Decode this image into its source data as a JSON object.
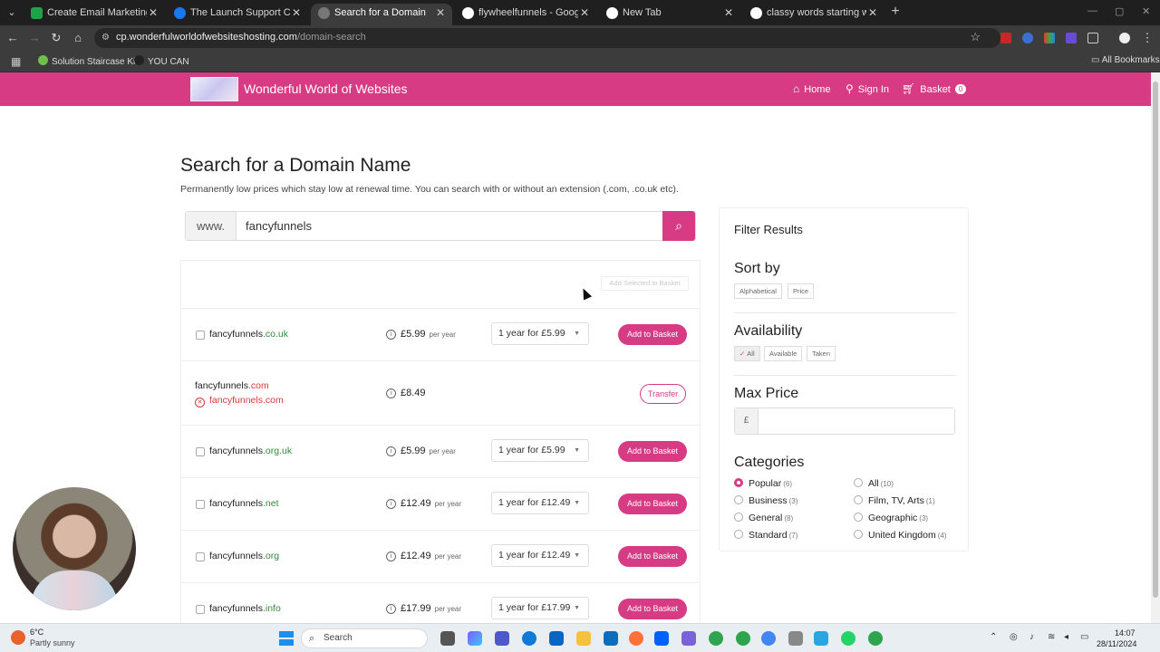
{
  "browser": {
    "tabs": [
      {
        "title": "Create Email Marketing Your A...",
        "fav_color": "#1fa34a"
      },
      {
        "title": "The Launch Support Club with",
        "fav_color": "#1877f2"
      },
      {
        "title": "Search for a Domain",
        "fav_color": "#888888"
      },
      {
        "title": "flywheelfunnels - Google Searc",
        "fav_color": "#ffffff"
      },
      {
        "title": "New Tab",
        "fav_color": "#ffffff"
      },
      {
        "title": "classy words starting with f - G",
        "fav_color": "#ffffff"
      }
    ],
    "url_host": "cp.wonderfulworldofwebsiteshosting.com",
    "url_path": "/domain-search",
    "bookmarks": [
      "Solution Staircase Ki...",
      "YOU CAN"
    ],
    "all_bookmarks": "All Bookmarks"
  },
  "site": {
    "name": "Wonderful World of Websites",
    "nav": {
      "home": "Home",
      "sign_in": "Sign In",
      "basket": "Basket",
      "basket_count": "0"
    },
    "brand_color": "#d63b84"
  },
  "main": {
    "heading": "Search for a Domain Name",
    "subtitle": "Permanently low prices which stay low at renewal time. You can search with or without an extension (.com, .co.uk etc).",
    "search": {
      "prefix": "www.",
      "value": "fancyfunnels"
    },
    "add_selected": "Add Selected to Basket",
    "results": [
      {
        "name": "fancyfunnels",
        "ext": ".co.uk",
        "price": "£5.99",
        "per": "per year",
        "term": "1 year for £5.99",
        "action": "Add to Basket"
      },
      {
        "name": "fancyfunnels",
        "ext": ".com",
        "price": "£8.49",
        "taken_label": "fancyfunnels.com",
        "action": "Transfer"
      },
      {
        "name": "fancyfunnels",
        "ext": ".org.uk",
        "price": "£5.99",
        "per": "per year",
        "term": "1 year for £5.99",
        "action": "Add to Basket"
      },
      {
        "name": "fancyfunnels",
        "ext": ".net",
        "price": "£12.49",
        "per": "per year",
        "term": "1 year for £12.49",
        "action": "Add to Basket"
      },
      {
        "name": "fancyfunnels",
        "ext": ".org",
        "price": "£12.49",
        "per": "per year",
        "term": "1 year for £12.49",
        "action": "Add to Basket"
      },
      {
        "name": "fancyfunnels",
        "ext": ".info",
        "price": "£17.99",
        "per": "per year",
        "term": "1 year for £17.99",
        "action": "Add to Basket"
      }
    ]
  },
  "filter": {
    "title": "Filter Results",
    "sort_by": {
      "label": "Sort by",
      "options": [
        "Alphabetical",
        "Price"
      ]
    },
    "availability": {
      "label": "Availability",
      "options": [
        "All",
        "Available",
        "Taken"
      ],
      "selected": "All"
    },
    "max_price": {
      "label": "Max Price",
      "currency": "£",
      "value": ""
    },
    "categories": {
      "label": "Categories",
      "items": [
        {
          "name": "Popular",
          "count": "(6)",
          "selected": true
        },
        {
          "name": "All",
          "count": "(10)",
          "selected": false
        },
        {
          "name": "Business",
          "count": "(3)",
          "selected": false
        },
        {
          "name": "Film, TV, Arts",
          "count": "(1)",
          "selected": false
        },
        {
          "name": "General",
          "count": "(8)",
          "selected": false
        },
        {
          "name": "Geographic",
          "count": "(3)",
          "selected": false
        },
        {
          "name": "Standard",
          "count": "(7)",
          "selected": false
        },
        {
          "name": "United Kingdom",
          "count": "(4)",
          "selected": false
        }
      ]
    }
  },
  "taskbar": {
    "weather_temp": "6°C",
    "weather_desc": "Partly sunny",
    "search_label": "Search",
    "time": "14:07",
    "date": "28/11/2024"
  }
}
